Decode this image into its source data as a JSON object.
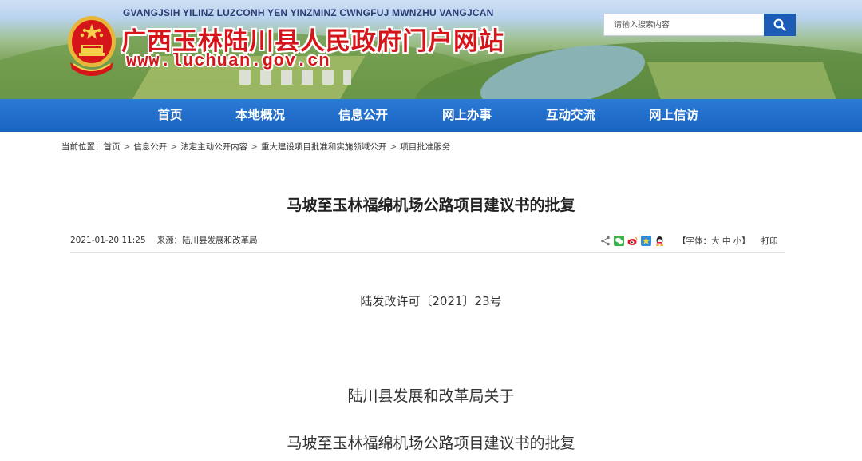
{
  "header": {
    "pinyin": "GVANGJSIH YILINZ LUZCONH YEN YINZMINZ CWNGFUJ MWNZHU VANGJCAN",
    "site_title": "广西玉林陆川县人民政府门户网站",
    "site_url": "www.luchuan.gov.cn",
    "search_placeholder": "请输入搜索内容",
    "title_color": "#d6151a"
  },
  "nav": {
    "background": "#1a64c0",
    "items": [
      {
        "label": "首页"
      },
      {
        "label": "本地概况"
      },
      {
        "label": "信息公开"
      },
      {
        "label": "网上办事"
      },
      {
        "label": "互动交流"
      },
      {
        "label": "网上信访"
      }
    ]
  },
  "breadcrumb": {
    "prefix": "当前位置：",
    "items": [
      "首页",
      "信息公开",
      "法定主动公开内容",
      "重大建设项目批准和实施领域公开",
      "项目批准服务"
    ],
    "separator": ">"
  },
  "article": {
    "title": "马坡至玉林福绵机场公路项目建议书的批复",
    "datetime": "2021-01-20 11:25",
    "source": "来源：陆川县发展和改革局",
    "share_icons": [
      "share-icon",
      "wechat-icon",
      "weibo-icon",
      "qzone-icon",
      "qq-icon"
    ],
    "font_size": {
      "prefix": "【字体：",
      "large": "大",
      "medium": "中",
      "small": "小",
      "suffix": "】"
    },
    "print_label": "打印",
    "doc_number": "陆发改许可〔2021〕23号",
    "body_line1": "陆川县发展和改革局关于",
    "body_line2": "马坡至玉林福绵机场公路项目建议书的批复"
  }
}
